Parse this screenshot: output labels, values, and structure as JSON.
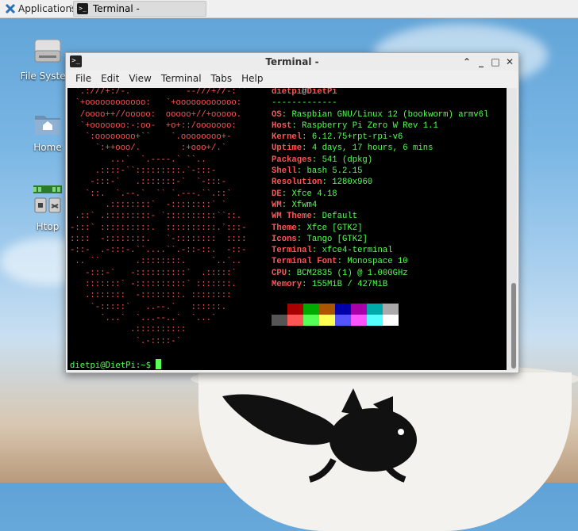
{
  "panel": {
    "applications_label": "Applications",
    "task_title": "Terminal -"
  },
  "desktop": {
    "icons": [
      {
        "label": "File System"
      },
      {
        "label": "Home"
      },
      {
        "label": "Htop"
      }
    ]
  },
  "window": {
    "title": "Terminal -",
    "menu": [
      "File",
      "Edit",
      "View",
      "Terminal",
      "Tabs",
      "Help"
    ]
  },
  "terminal": {
    "logo": " `.:///+:/-.           --///+//-:``\n `+oooooooooooo:   `+oooooooooooo:\n  /oooo++//ooooo:  ooooo+//+ooooo.\n  `+ooooooo:-:oo-  +o+::/ooooooo:\n   `:oooooooo+``    `.oooooooo+-\n     `:++ooo/.        :+ooo+/.`\n        ...`  `.----.` ``..\n     .::::-``:::::::::.`-:::-\n    -:::-`   .:::::::-`  `-:::-\n   `::.  `.--.`  `` `.---.``.::`\n       .::::::::`  -::::::::` `\n .::` .:::::::::- `::::::::::``::.\n-:::` ::::::::::.  ::::::::::.`:::-\n::::  -::::::::.   `-::::::::  ::::\n-::-  .-:::-.``....``.-::-::.  -::-\n .. ``       .::::::::.     `..`..\n   -:::-`   -::::::::::`  .:::::`\n   :::::::` -::::::::::` :::::::.\n   .:::::::  -::::::::. ::::::::\n    `-:::::`   ..--.`   ::::::.\n      `...`  `...--..`  `...`\n            .::::::::::\n             `.-::::-`",
    "user": "dietpi",
    "host": "DietPi",
    "separator": "-------------",
    "info": [
      {
        "key": "OS",
        "value": "Raspbian GNU/Linux 12 (bookworm) armv6l"
      },
      {
        "key": "Host",
        "value": "Raspberry Pi Zero W Rev 1.1"
      },
      {
        "key": "Kernel",
        "value": "6.12.75+rpt-rpi-v6"
      },
      {
        "key": "Uptime",
        "value": "4 days, 17 hours, 6 mins"
      },
      {
        "key": "Packages",
        "value": "541 (dpkg)"
      },
      {
        "key": "Shell",
        "value": "bash 5.2.15"
      },
      {
        "key": "Resolution",
        "value": "1280x960"
      },
      {
        "key": "DE",
        "value": "Xfce 4.18"
      },
      {
        "key": "WM",
        "value": "Xfwm4"
      },
      {
        "key": "WM Theme",
        "value": "Default"
      },
      {
        "key": "Theme",
        "value": "Xfce [GTK2]"
      },
      {
        "key": "Icons",
        "value": "Tango [GTK2]"
      },
      {
        "key": "Terminal",
        "value": "xfce4-terminal"
      },
      {
        "key": "Terminal Font",
        "value": "Monospace 10"
      },
      {
        "key": "CPU",
        "value": "BCM2835 (1) @ 1.000GHz"
      },
      {
        "key": "Memory",
        "value": "155MiB / 427MiB"
      }
    ],
    "palette_dark": [
      "#000000",
      "#aa0000",
      "#00aa00",
      "#aa5500",
      "#0000aa",
      "#aa00aa",
      "#00aaaa",
      "#aaaaaa"
    ],
    "palette_bright": [
      "#555555",
      "#ff5555",
      "#55ff55",
      "#ffff55",
      "#5555ff",
      "#ff55ff",
      "#55ffff",
      "#ffffff"
    ],
    "prompt": "dietpi@DietPi:~$ "
  }
}
